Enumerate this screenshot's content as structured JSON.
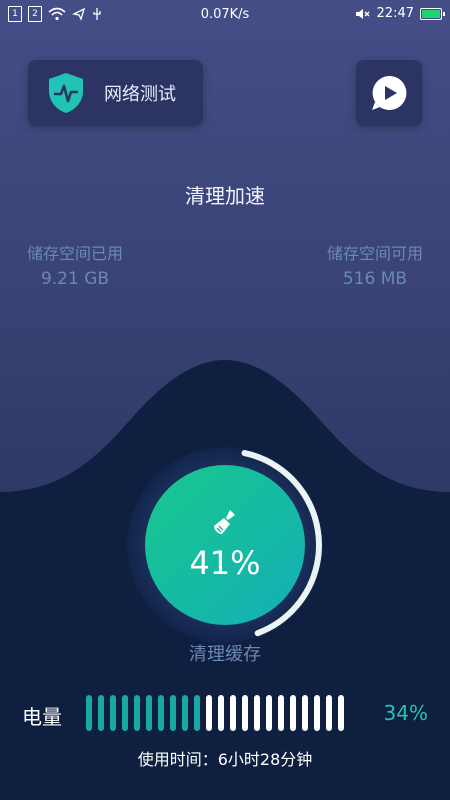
{
  "status_bar": {
    "sim1": "1",
    "sim2": "2",
    "speed": "0.07K/s",
    "time": "22:47",
    "battery_color": "#20d56f"
  },
  "top_buttons": {
    "network_test_label": "网络测试",
    "network_icon": "shield-pulse-icon",
    "play_icon": "play-bubble-icon"
  },
  "title": "清理加速",
  "storage": {
    "used_label": "储存空间已用",
    "used_value": "9.21 GB",
    "available_label": "储存空间可用",
    "available_value": "516 MB"
  },
  "gauge": {
    "percent_text": "41%",
    "percent": 0.41,
    "icon": "broom-icon",
    "accent_start": "#18c88c",
    "accent_end": "#14aeb7"
  },
  "clean_cache_label": "清理缓存",
  "battery": {
    "label": "电量",
    "percent_text": "34%",
    "filled_bars": 10,
    "total_bars": 22,
    "filled_color": "#1aa9a1",
    "empty_color": "#ffffff",
    "usage_text": "使用时间：6小时28分钟"
  }
}
